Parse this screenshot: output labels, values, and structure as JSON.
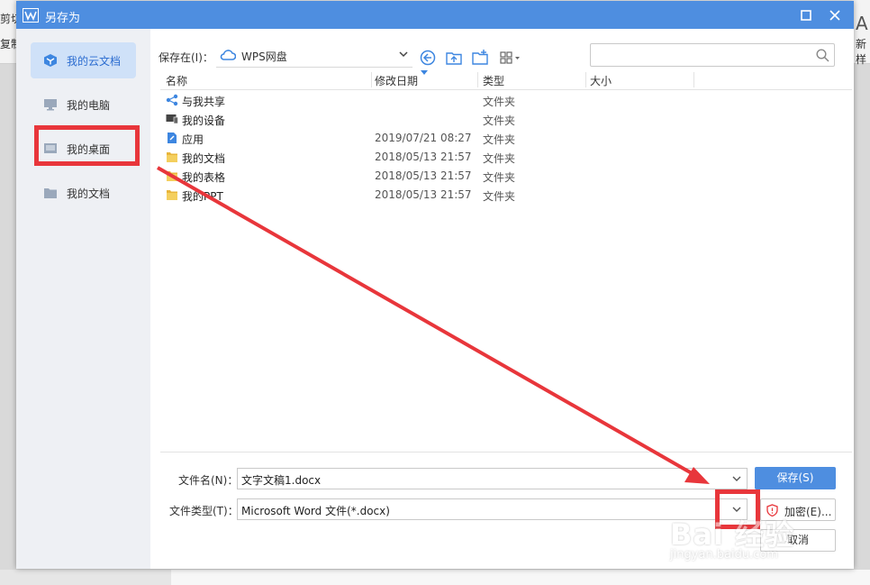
{
  "background_app": {
    "left_top": "剪切",
    "left_bottom": "复制",
    "right_top": "A",
    "right_bottom": "新样"
  },
  "dialog": {
    "title": "另存为"
  },
  "sidebar": {
    "items": [
      {
        "label": "我的云文档",
        "icon": "cloud-doc-icon"
      },
      {
        "label": "我的电脑",
        "icon": "computer-icon"
      },
      {
        "label": "我的桌面",
        "icon": "desktop-icon"
      },
      {
        "label": "我的文档",
        "icon": "folder-icon"
      }
    ]
  },
  "toolbar": {
    "save_in_label": "保存在(I)：",
    "location": "WPS网盘",
    "search_placeholder": ""
  },
  "columns": [
    "名称",
    "修改日期",
    "类型",
    "大小"
  ],
  "files": [
    {
      "name": "与我共享",
      "date": "",
      "type": "文件夹",
      "icon": "share-icon"
    },
    {
      "name": "我的设备",
      "date": "",
      "type": "文件夹",
      "icon": "device-icon"
    },
    {
      "name": "应用",
      "date": "2019/07/21 08:27",
      "type": "文件夹",
      "icon": "app-file-icon"
    },
    {
      "name": "我的文档",
      "date": "2018/05/13 21:57",
      "type": "文件夹",
      "icon": "folder-icon"
    },
    {
      "name": "我的表格",
      "date": "2018/05/13 21:57",
      "type": "文件夹",
      "icon": "folder-icon"
    },
    {
      "name": "我的PPT",
      "date": "2018/05/13 21:57",
      "type": "文件夹",
      "icon": "folder-icon"
    }
  ],
  "form": {
    "filename_label": "文件名(N)：",
    "filename_value": "文字文稿1.docx",
    "filetype_label": "文件类型(T)：",
    "filetype_value": "Microsoft Word 文件(*.docx)",
    "save_button": "保存(S)",
    "encrypt_button": "加密(E)...",
    "cancel_button": "取消"
  },
  "watermark": {
    "text": "Bai 经验",
    "sub": "jingyan.baidu.com"
  },
  "colors": {
    "titlebar": "#4e8ee0",
    "annotation": "#e8363b",
    "sidebar_active": "#cfe1f8"
  }
}
